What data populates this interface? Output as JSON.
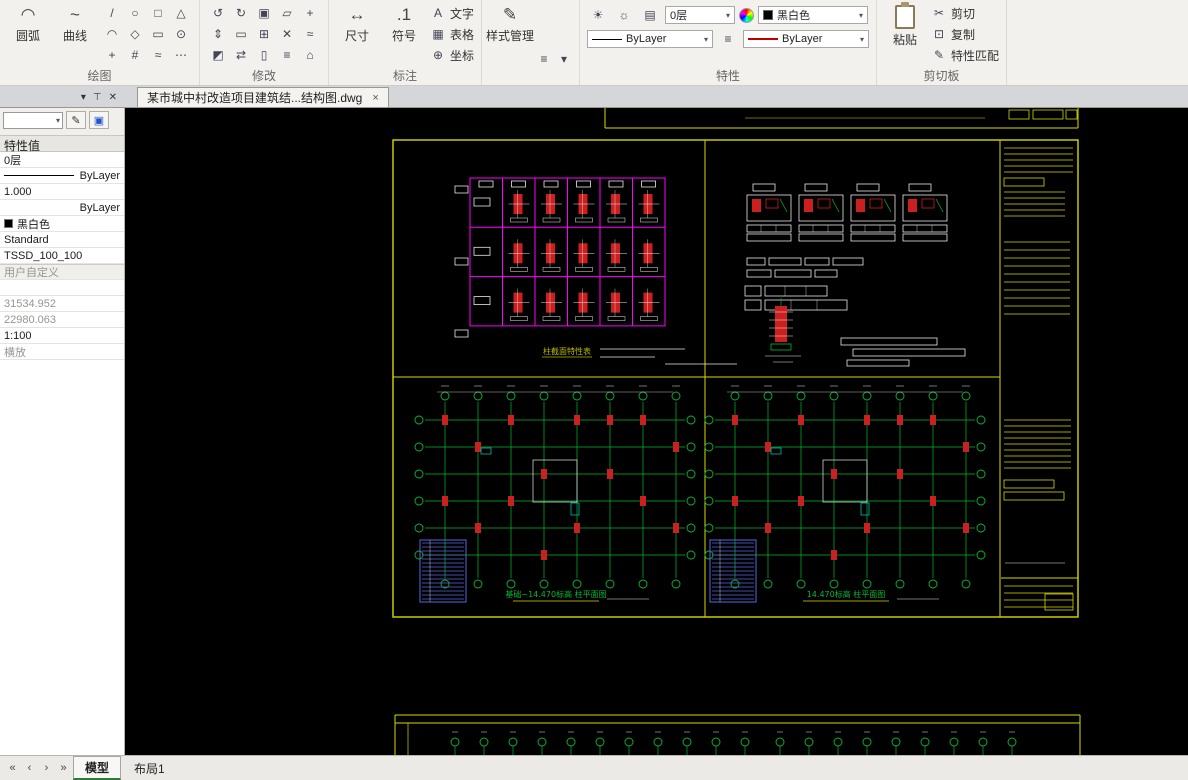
{
  "colors": {
    "frame": "#d8d800",
    "grid": "#ff00ff",
    "plan": "#00bb33",
    "detail": "#e8e8e8",
    "block": "#cc2020",
    "hatch": "#5868e0",
    "cyan": "#00b8b8",
    "title_text": "#b8b800",
    "canvas_bg": "#000000"
  },
  "icons": {
    "arc": "◠",
    "curve": "~",
    "dimension": "↔",
    "symbol": ".1",
    "text": "A",
    "table": "▦",
    "coordinate": "⊕",
    "style": "✎",
    "bulb": "☀",
    "sun": "☼",
    "printer": "▤",
    "lines": "≡",
    "cut": "✂",
    "copy": "⊡",
    "match": "✎",
    "chevron_down": "▾",
    "pin": "⊤",
    "close_panel": "✕",
    "nav_first": "«",
    "nav_prev": "‹",
    "nav_next": "›",
    "nav_last": "»",
    "menu": "≡",
    "edit": "✎",
    "box_blue": "▣"
  },
  "ribbon": {
    "group_labels": {
      "draw": "绘图",
      "modify": "修改",
      "annotate": "标注",
      "properties": "特性",
      "clipboard": "剪切板"
    },
    "draw": {
      "arc": "圆弧",
      "curve": "曲线",
      "small_icons": [
        "/",
        "○",
        "□",
        "△",
        "◠",
        "◇",
        "▭",
        "⊙",
        "+",
        "#",
        "≈",
        "⋯"
      ]
    },
    "modify": {
      "icons": [
        "↺",
        "↻",
        "▣",
        "▱",
        "+",
        "⇕",
        "▭",
        "⊞",
        "✕",
        "≈",
        "◩",
        "⇄",
        "▯",
        "≡",
        "⌂"
      ]
    },
    "annotate": {
      "dimension": "尺寸",
      "symbol": "符号",
      "text": "文字",
      "table": "表格",
      "coordinate": "坐标"
    },
    "style": {
      "manage": "样式管理"
    },
    "properties": {
      "layer_value": "0层",
      "color_value": "黑白色",
      "linetype_value": "ByLayer",
      "lineweight_value": "ByLayer"
    },
    "clipboard": {
      "paste": "粘贴",
      "cut": "剪切",
      "copy": "复制",
      "match": "特性匹配"
    }
  },
  "tab_bar": {
    "document_tab": "某市城中村改造项目建筑结...结构图.dwg",
    "close": "×"
  },
  "sidebar": {
    "panel_header": "特性值",
    "rows": [
      {
        "text": "0层"
      },
      {
        "text": "ByLayer",
        "align": "right",
        "sample": "line-black"
      },
      {
        "text": "1.000"
      },
      {
        "text": "ByLayer",
        "align": "right"
      },
      {
        "text": "黑白色",
        "swatch": "#000000"
      },
      {
        "text": "Standard"
      },
      {
        "text": "TSSD_100_100"
      },
      {
        "text": "用户自定义",
        "muted": true,
        "section": true
      },
      {
        "text": ""
      },
      {
        "text": "31534.952",
        "muted": true
      },
      {
        "text": "22980.063",
        "muted": true
      },
      {
        "text": "1:100"
      },
      {
        "text": "横放",
        "muted": true
      }
    ]
  },
  "canvas": {
    "table_title": "柱截面特性表",
    "plan_titles": [
      "基础~14.470标高 柱平面图",
      "14.470标高 柱平面图"
    ]
  },
  "bottom_bar": {
    "model_tab": "模型",
    "layout_tab": "布局1"
  }
}
